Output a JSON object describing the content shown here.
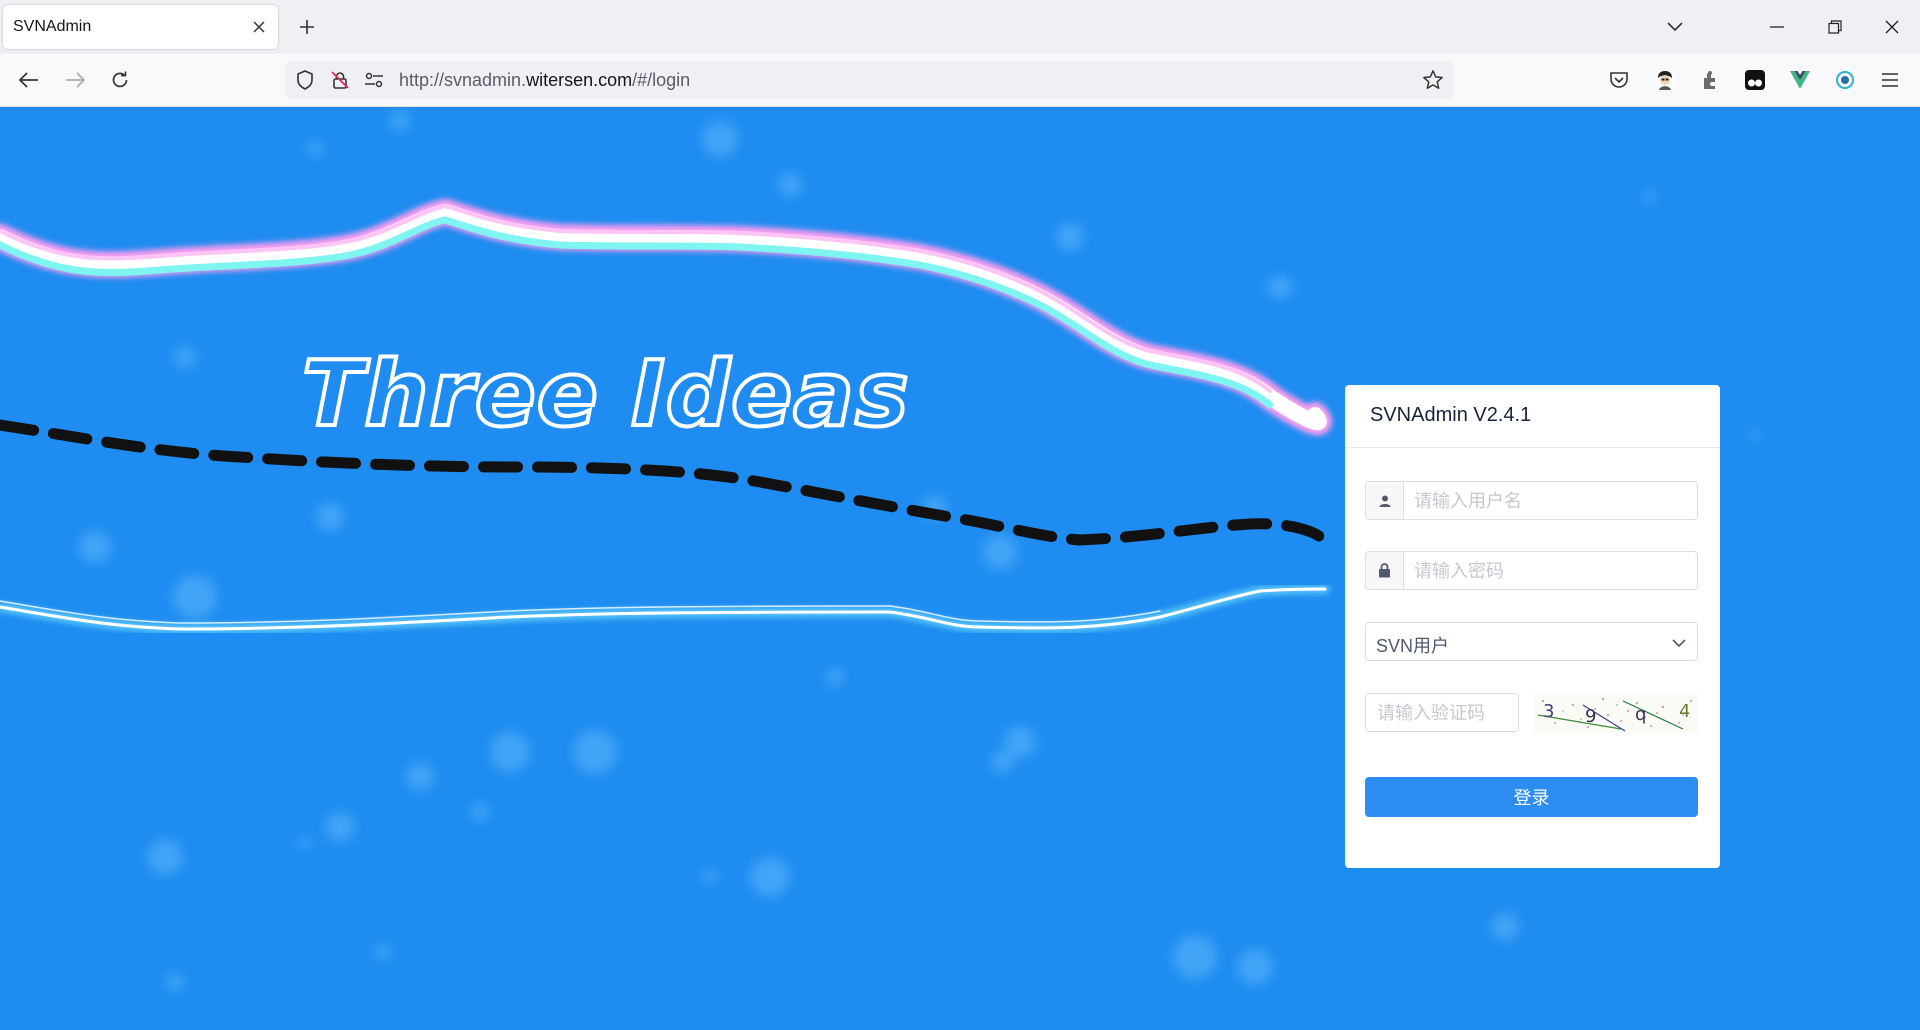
{
  "browser": {
    "tab_title": "SVNAdmin",
    "url_prefix": "http://svnadmin.",
    "url_host": "witersen.com",
    "url_path": "/#/login"
  },
  "login": {
    "title": "SVNAdmin V2.4.1",
    "username_placeholder": "请输入用户名",
    "password_placeholder": "请输入密码",
    "role_selected": "SVN用户",
    "captcha_placeholder": "请输入验证码",
    "captcha_chars": [
      "3",
      "9",
      "q",
      "4"
    ],
    "submit_label": "登录"
  },
  "background": {
    "logo_text": "Three Ideas"
  },
  "colors": {
    "page_bg": "#1e8cf0",
    "primary_button": "#2d8cf0"
  }
}
